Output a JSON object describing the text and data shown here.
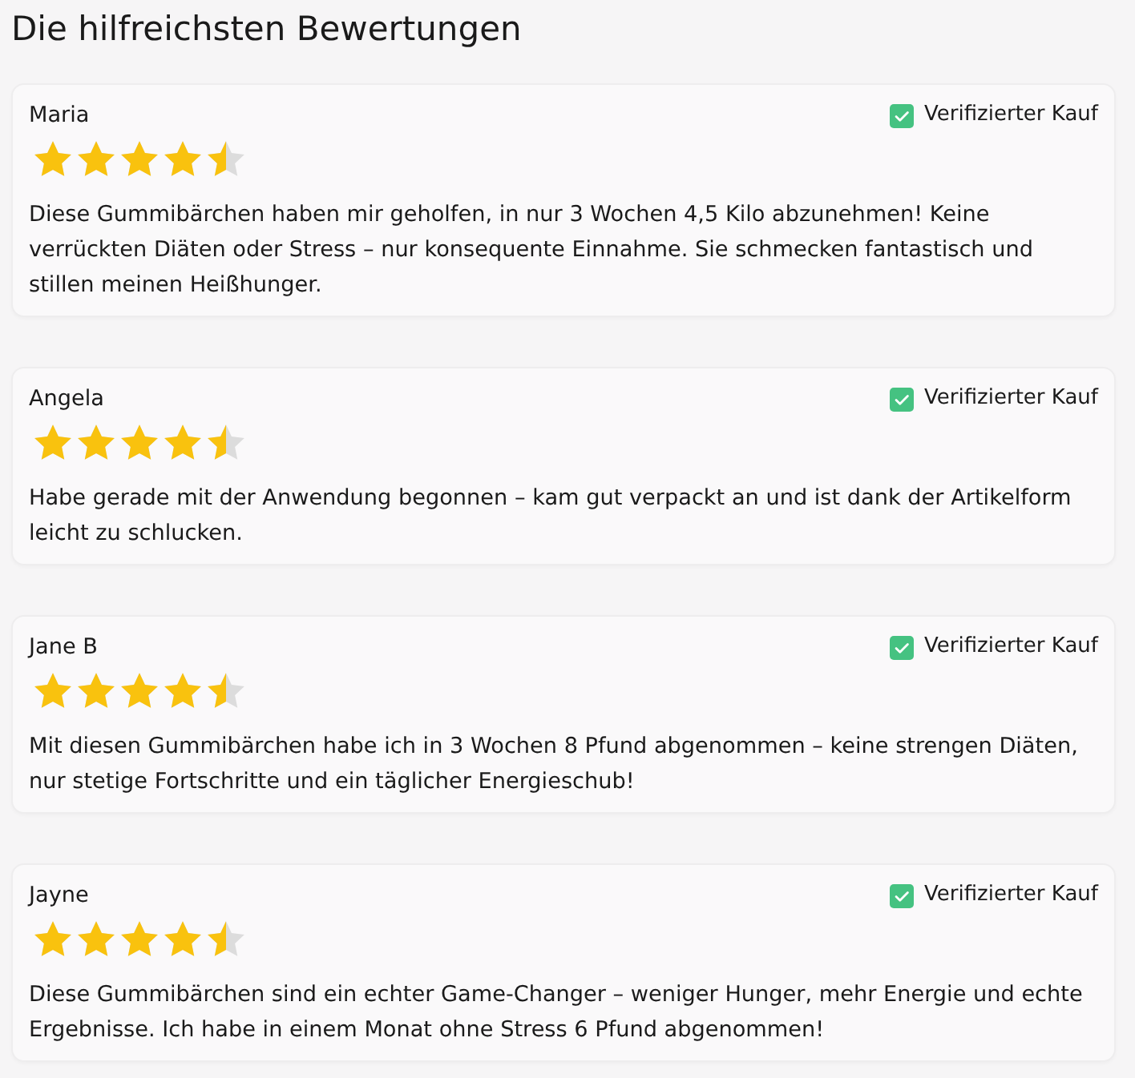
{
  "heading": "Die hilfreichsten Bewertungen",
  "reviews": [
    {
      "author": "Maria",
      "verified": true,
      "verified_label": "Verifizierter Kauf",
      "stars": 4.5,
      "text": "Diese Gummibärchen haben mir geholfen, in nur 3 Wochen 4,5 Kilo abzunehmen! Keine verrückten Diäten oder Stress – nur konsequente Einnahme. Sie schmecken fantastisch und stillen meinen Heißhunger."
    },
    {
      "author": "Angela",
      "verified": true,
      "verified_label": "Verifizierter Kauf",
      "stars": 4.5,
      "text": "Habe gerade mit der Anwendung begonnen – kam gut verpackt an und ist dank der Artikelform leicht zu schlucken."
    },
    {
      "author": "Jane B",
      "verified": true,
      "verified_label": "Verifizierter Kauf",
      "stars": 4.5,
      "text": "Mit diesen Gummibärchen habe ich in 3 Wochen 8 Pfund abgenommen – keine strengen Diäten, nur stetige Fortschritte und ein täglicher Energieschub!"
    },
    {
      "author": "Jayne",
      "verified": true,
      "verified_label": "Verifizierter Kauf",
      "stars": 4.5,
      "text": "Diese Gummibärchen sind ein echter Game-Changer – weniger Hunger, mehr Energie und echte Ergebnisse. Ich habe in einem Monat ohne Stress 6 Pfund abgenommen!"
    }
  ]
}
